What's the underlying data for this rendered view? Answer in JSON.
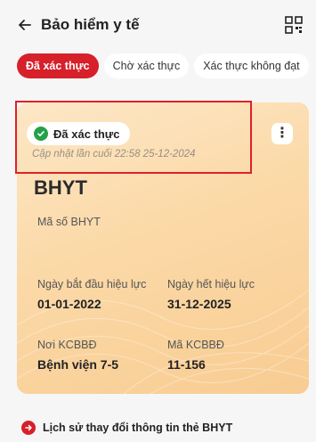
{
  "header": {
    "back_icon": "arrow-left-icon",
    "title": "Bảo hiểm y tế",
    "qr_icon": "qr-code-icon"
  },
  "tabs": [
    {
      "label": "Đã xác thực",
      "active": true
    },
    {
      "label": "Chờ xác thực",
      "active": false
    },
    {
      "label": "Xác thực không đạt",
      "active": false
    }
  ],
  "card": {
    "status": "Đã xác thực",
    "status_color": "#24a148",
    "updated": "Cập nhật lần cuối 22:58 25-12-2024",
    "type": "BHYT",
    "number_label": "Mã số BHYT",
    "number_value": "",
    "start_label": "Ngày bắt đầu hiệu lực",
    "start_value": "01-01-2022",
    "end_label": "Ngày hết hiệu lực",
    "end_value": "31-12-2025",
    "place_label": "Nơi KCBBĐ",
    "place_value": "Bệnh viện 7-5",
    "code_label": "Mã KCBBĐ",
    "code_value": "11-156"
  },
  "history_link": "Lịch sử thay đổi thông tin thẻ BHYT",
  "colors": {
    "accent": "#d6202a",
    "success": "#24a148"
  }
}
